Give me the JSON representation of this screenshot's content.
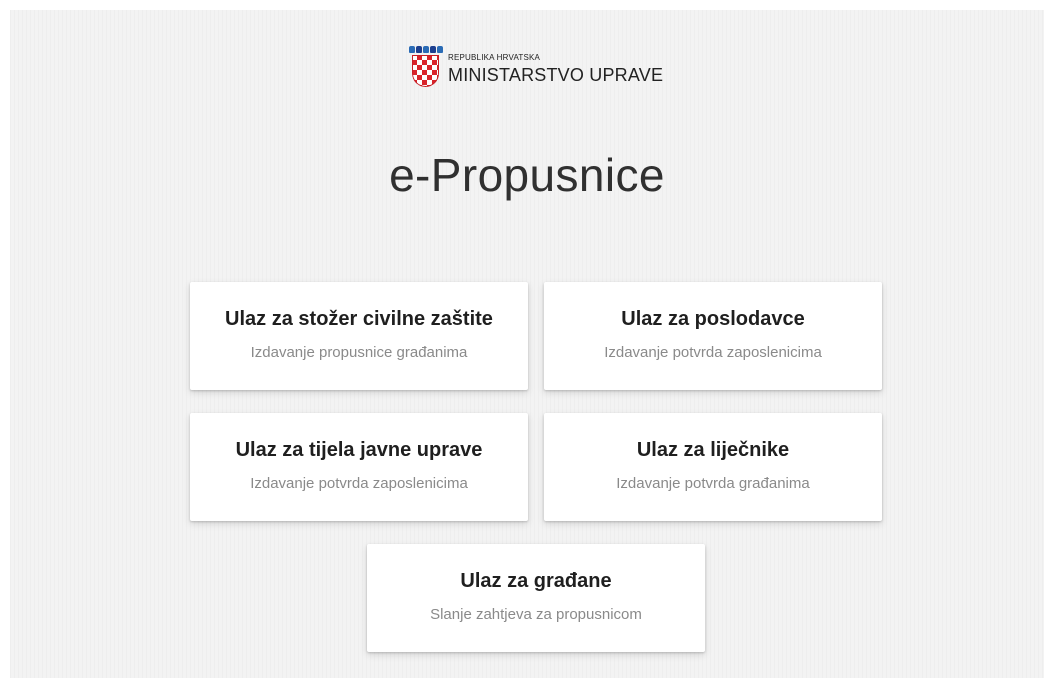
{
  "header": {
    "logo_top": "REPUBLIKA HRVATSKA",
    "logo_main": "MINISTARSTVO UPRAVE",
    "logo_icon": "croatian-coat-of-arms-icon"
  },
  "page_title": "e-Propusnice",
  "cards": [
    {
      "title": "Ulaz za stožer civilne zaštite",
      "subtitle": "Izdavanje propusnice građanima"
    },
    {
      "title": "Ulaz za poslodavce",
      "subtitle": "Izdavanje potvrda zaposlenicima"
    },
    {
      "title": "Ulaz za tijela javne uprave",
      "subtitle": "Izdavanje potvrda zaposlenicima"
    },
    {
      "title": "Ulaz za liječnike",
      "subtitle": "Izdavanje potvrda građanima"
    },
    {
      "title": "Ulaz za građane",
      "subtitle": "Slanje zahtjeva za propusnicom"
    }
  ],
  "colors": {
    "shield_red": "#d8232a",
    "page_background": "#f3f3f3",
    "card_background": "#ffffff"
  }
}
